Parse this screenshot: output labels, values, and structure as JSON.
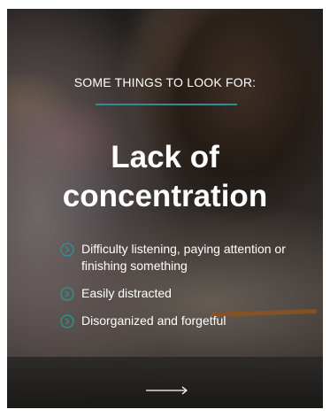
{
  "card": {
    "kicker": "SOME THINGS TO LOOK FOR:",
    "headline_line1": "Lack of",
    "headline_line2": "concentration",
    "items": [
      {
        "label": "Difficulty listening, paying attention or finishing something"
      },
      {
        "label": "Easily distracted"
      },
      {
        "label": "Disorganized and forgetful"
      }
    ],
    "bullet_icon": "chevron-right-circle-icon",
    "next_icon": "arrow-right-icon"
  },
  "colors": {
    "accent": "#2e8f91",
    "text": "#ffffff"
  }
}
